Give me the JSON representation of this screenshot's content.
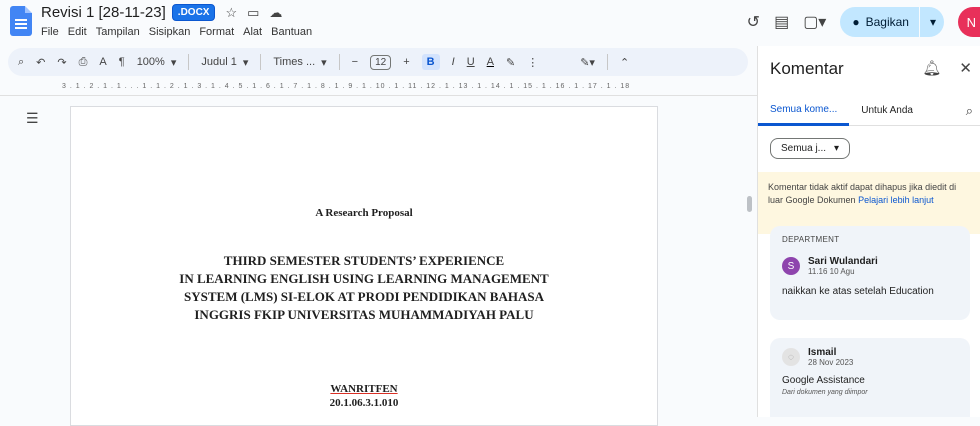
{
  "doc": {
    "title": "Revisi 1 [28-11-23]",
    "badge": ".DOCX"
  },
  "menu": [
    "File",
    "Edit",
    "Tampilan",
    "Sisipkan",
    "Format",
    "Alat",
    "Bantuan"
  ],
  "share_label": "Bagikan",
  "user_initial": "N",
  "toolbar": {
    "zoom": "100%",
    "style": "Judul 1",
    "font": "Times ...",
    "font_size": "12",
    "bold": "B",
    "italic": "I",
    "underline": "U",
    "text_color": "A"
  },
  "ruler_text": "3 . 1 . 2 . 1 . 1 . . . 1 . 1 . 2 . 1 . 3 . 1 . 4 . 5 . 1 . 6 . 1 . 7 . 1 . 8 . 1 . 9 . 1 . 10 . 1 . 11 . 12 . 1 . 13 . 1 . 14 . 1 . 15 . 1 . 16 . 1 . 17 . 1 . 18",
  "page": {
    "subtitle": "A Research Proposal",
    "title_lines": [
      "THIRD SEMESTER STUDENTS’ EXPERIENCE",
      "IN LEARNING ENGLISH USING LEARNING MANAGEMENT",
      "SYSTEM (LMS) SI-ELOK AT PRODI PENDIDIKAN BAHASA",
      "INGGRIS FKIP UNIVERSITAS MUHAMMADIYAH PALU"
    ],
    "author": "WANRITFEN",
    "student_id": "20.1.06.3.1.010"
  },
  "panel": {
    "title": "Komentar",
    "tabs": [
      "Semua kome...",
      "Untuk Anda"
    ],
    "filter": "Semua j...",
    "notice": "Komentar tidak aktif dapat dihapus jika diedit di luar Google Dokumen",
    "notice_link": "Pelajari lebih lanjut",
    "comments": [
      {
        "label": "DEPARTMENT",
        "initial": "S",
        "name": "Sari Wulandari",
        "time": "11.16 10 Agu",
        "text": "naikkan ke atas setelah Education"
      },
      {
        "name": "Ismail",
        "time": "28 Nov 2023",
        "text": "Google Assistance",
        "sub": "Dari dokumen yang diimpor"
      }
    ]
  },
  "colors": {
    "accent": "#0b57d0",
    "share_bg": "#c2e7ff",
    "avatar_comment": "#8e44ad"
  }
}
